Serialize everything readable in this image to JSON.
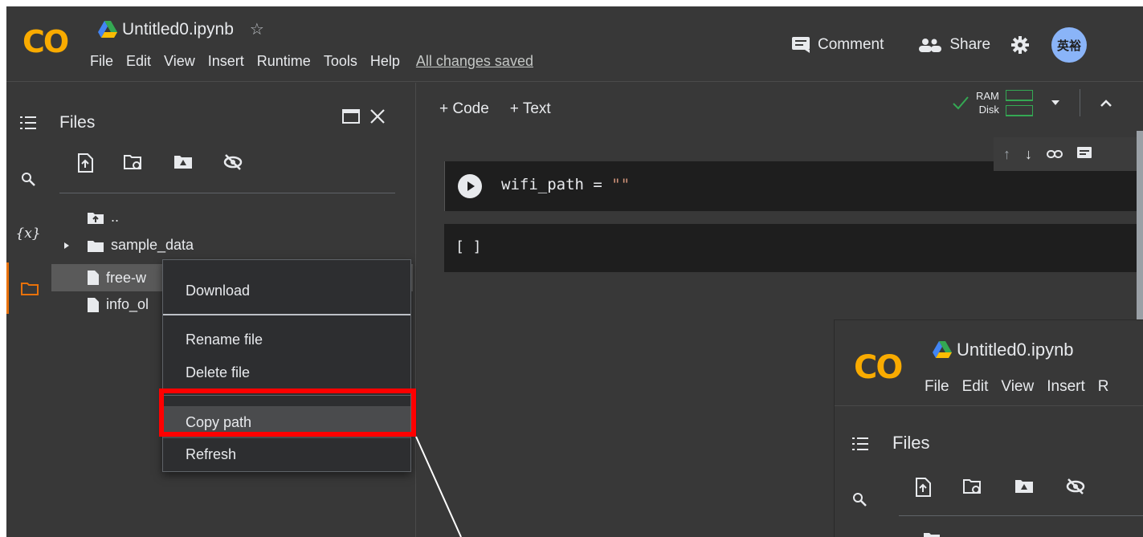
{
  "logo": "CO",
  "notebook": {
    "title": "Untitled0.ipynb",
    "star": "☆",
    "saved_status": "All changes saved"
  },
  "menu": [
    "File",
    "Edit",
    "View",
    "Insert",
    "Runtime",
    "Tools",
    "Help"
  ],
  "header_actions": {
    "comment_label": "Comment",
    "share_label": "Share",
    "avatar_text": "英裕"
  },
  "sidebar": {
    "files_title": "Files",
    "tree": [
      {
        "label": "..",
        "type": "parent"
      },
      {
        "label": "sample_data",
        "type": "folder"
      },
      {
        "label": "free-w",
        "type": "file"
      },
      {
        "label": "info_ol",
        "type": "file"
      }
    ]
  },
  "context_menu": {
    "items": [
      "Download",
      "Rename file",
      "Delete file",
      "Copy path",
      "Refresh"
    ],
    "highlighted": "Copy path"
  },
  "toolbar": {
    "code_label": "+ Code",
    "text_label": "+ Text",
    "ram_label": "RAM",
    "disk_label": "Disk"
  },
  "cells": {
    "code_prefix": "wifi_path = ",
    "code_string": "\"\"",
    "output_brackets": "[ ]"
  },
  "inset": {
    "title": "Untitled0.ipynb",
    "menu": [
      "File",
      "Edit",
      "View",
      "Insert",
      "R"
    ],
    "files_title": "Files"
  },
  "colors": {
    "background": "#383838",
    "highlight": "#ff0000",
    "logo_yellow": "#f9ab00",
    "logo_orange": "#e8710a",
    "status_green": "#34a853"
  }
}
